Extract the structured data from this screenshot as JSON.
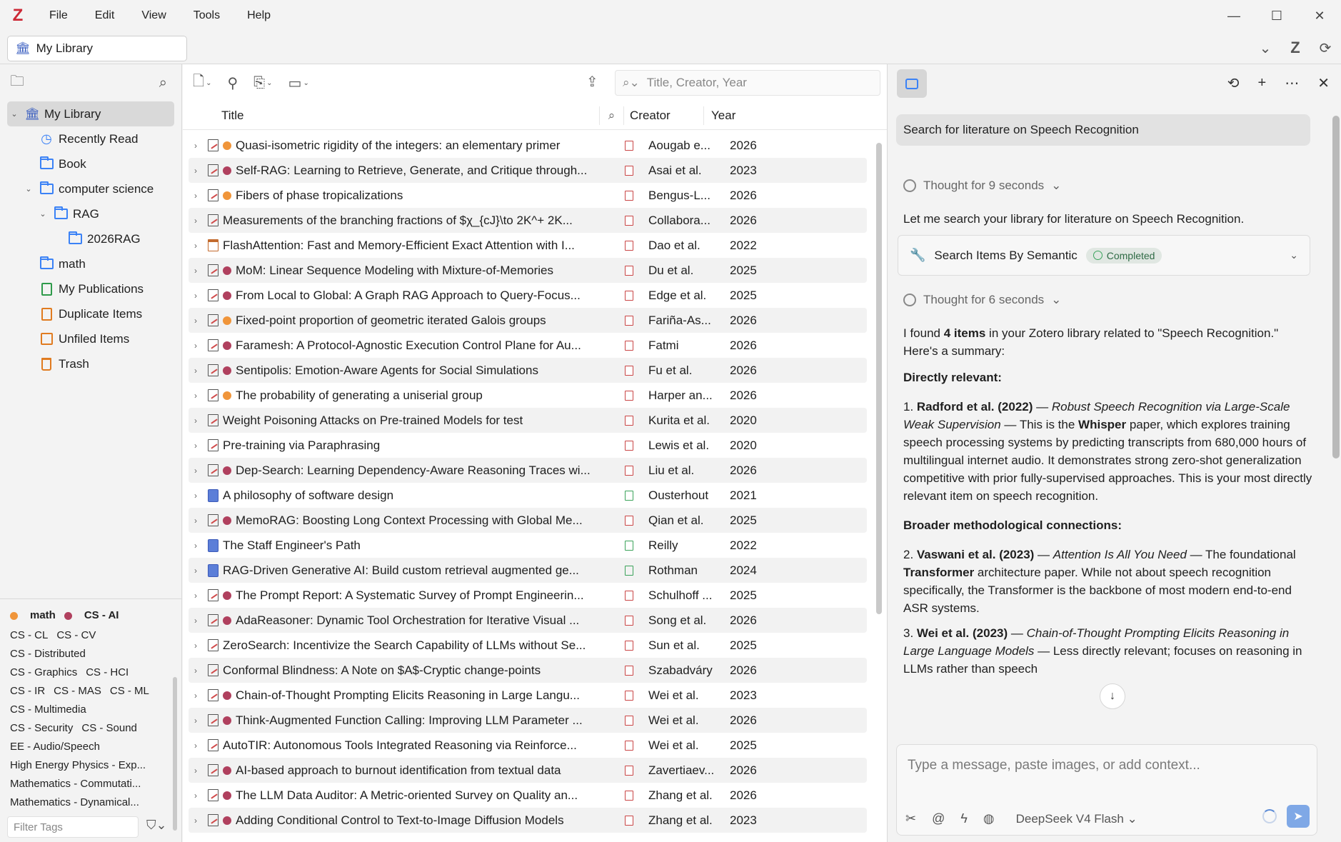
{
  "app": {
    "logo": "Z",
    "menu": [
      "File",
      "Edit",
      "View",
      "Tools",
      "Help"
    ],
    "window_controls": {
      "minimize": "—",
      "maximize": "☐",
      "close": "✕"
    }
  },
  "library_bar": {
    "selected": "My Library"
  },
  "collections": [
    {
      "label": "My Library",
      "icon": "library-icon",
      "level": 0,
      "twisty": "⌄",
      "selected": true
    },
    {
      "label": "Recently Read",
      "icon": "clock-icon",
      "level": 1
    },
    {
      "label": "Book",
      "icon": "folder-icon",
      "level": 1
    },
    {
      "label": "computer science",
      "icon": "folder-icon",
      "level": 1,
      "twisty": "⌄"
    },
    {
      "label": "RAG",
      "icon": "folder-icon",
      "level": 2,
      "twisty": "⌄"
    },
    {
      "label": "2026RAG",
      "icon": "folder-icon",
      "level": 3
    },
    {
      "label": "math",
      "icon": "folder-icon",
      "level": 1
    },
    {
      "label": "My Publications",
      "icon": "publications-icon",
      "level": 1
    },
    {
      "label": "Duplicate Items",
      "icon": "duplicate-icon",
      "level": 1
    },
    {
      "label": "Unfiled Items",
      "icon": "unfiled-icon",
      "level": 1
    },
    {
      "label": "Trash",
      "icon": "trash-icon",
      "level": 1
    }
  ],
  "tags": {
    "colored": [
      {
        "label": "math",
        "color": "#f0953a"
      },
      {
        "label": "CS - AI",
        "color": "#b0405e"
      }
    ],
    "rows": [
      [
        "CS - CL",
        "CS - CV"
      ],
      [
        "CS - Distributed"
      ],
      [
        "CS - Graphics",
        "CS - HCI"
      ],
      [
        "CS - IR",
        "CS - MAS",
        "CS - ML"
      ],
      [
        "CS - Multimedia"
      ],
      [
        "CS - Security",
        "CS - Sound"
      ],
      [
        "EE - Audio/Speech"
      ],
      [
        "High Energy Physics - Exp..."
      ],
      [
        "Mathematics - Commutati..."
      ],
      [
        "Mathematics - Dynamical..."
      ]
    ],
    "filter_placeholder": "Filter Tags"
  },
  "items_toolbar": {
    "search_placeholder": "Title, Creator, Year"
  },
  "columns": {
    "title": "Title",
    "creator": "Creator",
    "year": "Year"
  },
  "items": [
    {
      "type": "preprint",
      "dot": "#f0953a",
      "title": "Quasi-isometric rigidity of the integers: an elementary primer",
      "att": "pdf",
      "creator": "Aougab e...",
      "year": "2026"
    },
    {
      "type": "preprint",
      "dot": "#b0405e",
      "title": "Self-RAG: Learning to Retrieve, Generate, and Critique through...",
      "att": "pdf",
      "creator": "Asai et al.",
      "year": "2023"
    },
    {
      "type": "preprint",
      "dot": "#f0953a",
      "title": "Fibers of phase tropicalizations",
      "att": "pdf",
      "creator": "Bengus-L...",
      "year": "2026"
    },
    {
      "type": "preprint",
      "dot": "",
      "title": "Measurements of the branching fractions of $χ_{cJ}\\to 2K^+ 2K...",
      "att": "pdf",
      "creator": "Collabora...",
      "year": "2026"
    },
    {
      "type": "conference",
      "dot": "",
      "title": "FlashAttention: Fast and Memory-Efficient Exact Attention with I...",
      "att": "pdf",
      "creator": "Dao et al.",
      "year": "2022"
    },
    {
      "type": "preprint",
      "dot": "#b0405e",
      "title": "MoM: Linear Sequence Modeling with Mixture-of-Memories",
      "att": "pdf",
      "creator": "Du et al.",
      "year": "2025"
    },
    {
      "type": "preprint",
      "dot": "#b0405e",
      "title": "From Local to Global: A Graph RAG Approach to Query-Focus...",
      "att": "pdf",
      "creator": "Edge et al.",
      "year": "2025"
    },
    {
      "type": "preprint",
      "dot": "#f0953a",
      "title": "Fixed-point proportion of geometric iterated Galois groups",
      "att": "pdf",
      "creator": "Fariña-As...",
      "year": "2026"
    },
    {
      "type": "preprint",
      "dot": "#b0405e",
      "title": "Faramesh: A Protocol-Agnostic Execution Control Plane for Au...",
      "att": "pdf",
      "creator": "Fatmi",
      "year": "2026"
    },
    {
      "type": "preprint",
      "dot": "#b0405e",
      "title": "Sentipolis: Emotion-Aware Agents for Social Simulations",
      "att": "pdf",
      "creator": "Fu et al.",
      "year": "2026"
    },
    {
      "type": "preprint",
      "dot": "#f0953a",
      "title": "The probability of generating a uniserial group",
      "att": "pdf",
      "creator": "Harper an...",
      "year": "2026"
    },
    {
      "type": "preprint",
      "dot": "",
      "title": "Weight Poisoning Attacks on Pre-trained Models for test",
      "att": "pdf",
      "creator": "Kurita et al.",
      "year": "2020"
    },
    {
      "type": "preprint",
      "dot": "",
      "title": "Pre-training via Paraphrasing",
      "att": "pdf",
      "creator": "Lewis et al.",
      "year": "2020"
    },
    {
      "type": "preprint",
      "dot": "#b0405e",
      "title": "Dep-Search: Learning Dependency-Aware Reasoning Traces wi...",
      "att": "pdf",
      "creator": "Liu et al.",
      "year": "2026"
    },
    {
      "type": "book",
      "dot": "",
      "title": "A philosophy of software design",
      "att": "epub",
      "creator": "Ousterhout",
      "year": "2021"
    },
    {
      "type": "preprint",
      "dot": "#b0405e",
      "title": "MemoRAG: Boosting Long Context Processing with Global Me...",
      "att": "pdf",
      "creator": "Qian et al.",
      "year": "2025"
    },
    {
      "type": "book",
      "dot": "",
      "title": "The Staff Engineer's Path",
      "att": "epub",
      "creator": "Reilly",
      "year": "2022"
    },
    {
      "type": "book",
      "dot": "",
      "title": "RAG-Driven Generative AI: Build custom retrieval augmented ge...",
      "att": "epub",
      "creator": "Rothman",
      "year": "2024"
    },
    {
      "type": "preprint",
      "dot": "#b0405e",
      "title": "The Prompt Report: A Systematic Survey of Prompt Engineerin...",
      "att": "pdf",
      "creator": "Schulhoff ...",
      "year": "2025"
    },
    {
      "type": "preprint",
      "dot": "#b0405e",
      "title": "AdaReasoner: Dynamic Tool Orchestration for Iterative Visual ...",
      "att": "pdf",
      "creator": "Song et al.",
      "year": "2026"
    },
    {
      "type": "preprint",
      "dot": "",
      "title": "ZeroSearch: Incentivize the Search Capability of LLMs without Se...",
      "att": "pdf",
      "creator": "Sun et al.",
      "year": "2025"
    },
    {
      "type": "preprint",
      "dot": "",
      "title": "Conformal Blindness: A Note on $A$-Cryptic change-points",
      "att": "pdf",
      "creator": "Szabadváry",
      "year": "2026"
    },
    {
      "type": "preprint",
      "dot": "#b0405e",
      "title": "Chain-of-Thought Prompting Elicits Reasoning in Large Langu...",
      "att": "pdf",
      "creator": "Wei et al.",
      "year": "2023"
    },
    {
      "type": "preprint",
      "dot": "#b0405e",
      "title": "Think-Augmented Function Calling: Improving LLM Parameter ...",
      "att": "pdf",
      "creator": "Wei et al.",
      "year": "2026"
    },
    {
      "type": "preprint",
      "dot": "",
      "title": "AutoTIR: Autonomous Tools Integrated Reasoning via Reinforce...",
      "att": "pdf",
      "creator": "Wei et al.",
      "year": "2025"
    },
    {
      "type": "preprint",
      "dot": "#b0405e",
      "title": "AI-based approach to burnout identification from textual data",
      "att": "pdf",
      "creator": "Zavertiaev...",
      "year": "2026"
    },
    {
      "type": "preprint",
      "dot": "#b0405e",
      "title": "The LLM Data Auditor: A Metric-oriented Survey on Quality an...",
      "att": "pdf",
      "creator": "Zhang et al.",
      "year": "2026"
    },
    {
      "type": "preprint",
      "dot": "#b0405e",
      "title": "Adding Conditional Control to Text-to-Image Diffusion Models",
      "att": "pdf",
      "creator": "Zhang et al.",
      "year": "2023"
    }
  ],
  "chat": {
    "user_message": "Search for literature on Speech Recognition",
    "thought1": "Thought for 9 seconds",
    "intro": "Let me search your library for literature on Speech Recognition.",
    "tool_name": "Search Items By Semantic",
    "tool_status": "Completed",
    "thought2": "Thought for 6 seconds",
    "found_a": "I found ",
    "found_b": "4 items",
    "found_c": " in your Zotero library related to \"Speech Recognition.\" Here's a summary:",
    "section1": "Directly relevant:",
    "item1_num": "1. ",
    "item1_author": "Radford et al. (2022)",
    "item1_dash": " — ",
    "item1_title": "Robust Speech Recognition via Large-Scale Weak Supervision",
    "item1_mid": " — This is the ",
    "item1_bold": "Whisper",
    "item1_rest": " paper, which explores training speech processing systems by predicting transcripts from 680,000 hours of multilingual internet audio. It demonstrates strong zero-shot generalization competitive with prior fully-supervised approaches. This is your most directly relevant item on speech recognition.",
    "section2": "Broader methodological connections:",
    "item2_num": "2.  ",
    "item2_author": "Vaswani et al. (2023)",
    "item2_dash": " — ",
    "item2_title": "Attention Is All You Need",
    "item2_mid": " — The foundational ",
    "item2_bold": "Transformer",
    "item2_rest": " architecture paper. While not about speech recognition specifically, the Transformer is the backbone of most modern end-to-end ASR systems.",
    "item3_num": "3.  ",
    "item3_author": "Wei et al. (2023)",
    "item3_dash": " — ",
    "item3_title": "Chain-of-Thought Prompting Elicits Reasoning in Large Language Models",
    "item3_rest": " — Less directly relevant; focuses on reasoning in LLMs rather than speech",
    "composer_placeholder": "Type a message, paste images, or add context...",
    "model": "DeepSeek V4 Flash"
  }
}
